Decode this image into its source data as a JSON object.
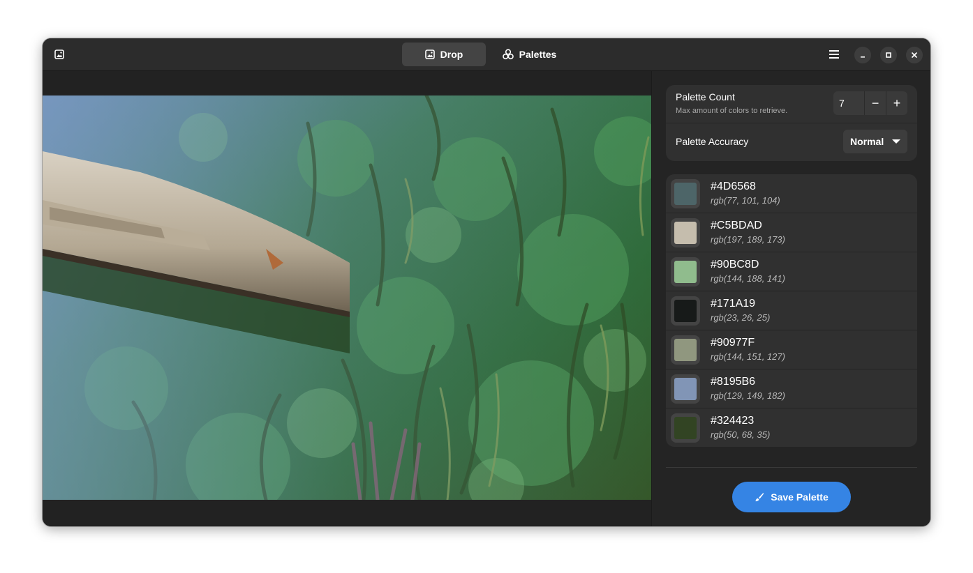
{
  "header": {
    "app_icon": "image-icon",
    "tabs": [
      {
        "label": "Drop",
        "icon": "image-icon",
        "active": true
      },
      {
        "label": "Palettes",
        "icon": "palette-circles-icon",
        "active": false
      }
    ],
    "menu_icon": "hamburger-menu-icon",
    "window_controls": [
      "minimize-icon",
      "maximize-icon",
      "close-icon"
    ]
  },
  "settings": {
    "count_title": "Palette Count",
    "count_subtitle": "Max amount of colors to retrieve.",
    "count_value": "7",
    "decrement_label": "−",
    "increment_label": "+",
    "accuracy_title": "Palette Accuracy",
    "accuracy_value": "Normal"
  },
  "colors": [
    {
      "hex": "#4D6568",
      "rgb": "rgb(77, 101, 104)"
    },
    {
      "hex": "#C5BDAD",
      "rgb": "rgb(197, 189, 173)"
    },
    {
      "hex": "#90BC8D",
      "rgb": "rgb(144, 188, 141)"
    },
    {
      "hex": "#171A19",
      "rgb": "rgb(23, 26, 25)"
    },
    {
      "hex": "#90977F",
      "rgb": "rgb(144, 151, 127)"
    },
    {
      "hex": "#8195B6",
      "rgb": "rgb(129, 149, 182)"
    },
    {
      "hex": "#324423",
      "rgb": "rgb(50, 68, 35)"
    }
  ],
  "save_button": {
    "label": "Save Palette",
    "icon": "paintbrush-icon",
    "color": "#3584e4"
  },
  "photo": {
    "subject": "wooden-canoe-over-aquatic-plants"
  }
}
